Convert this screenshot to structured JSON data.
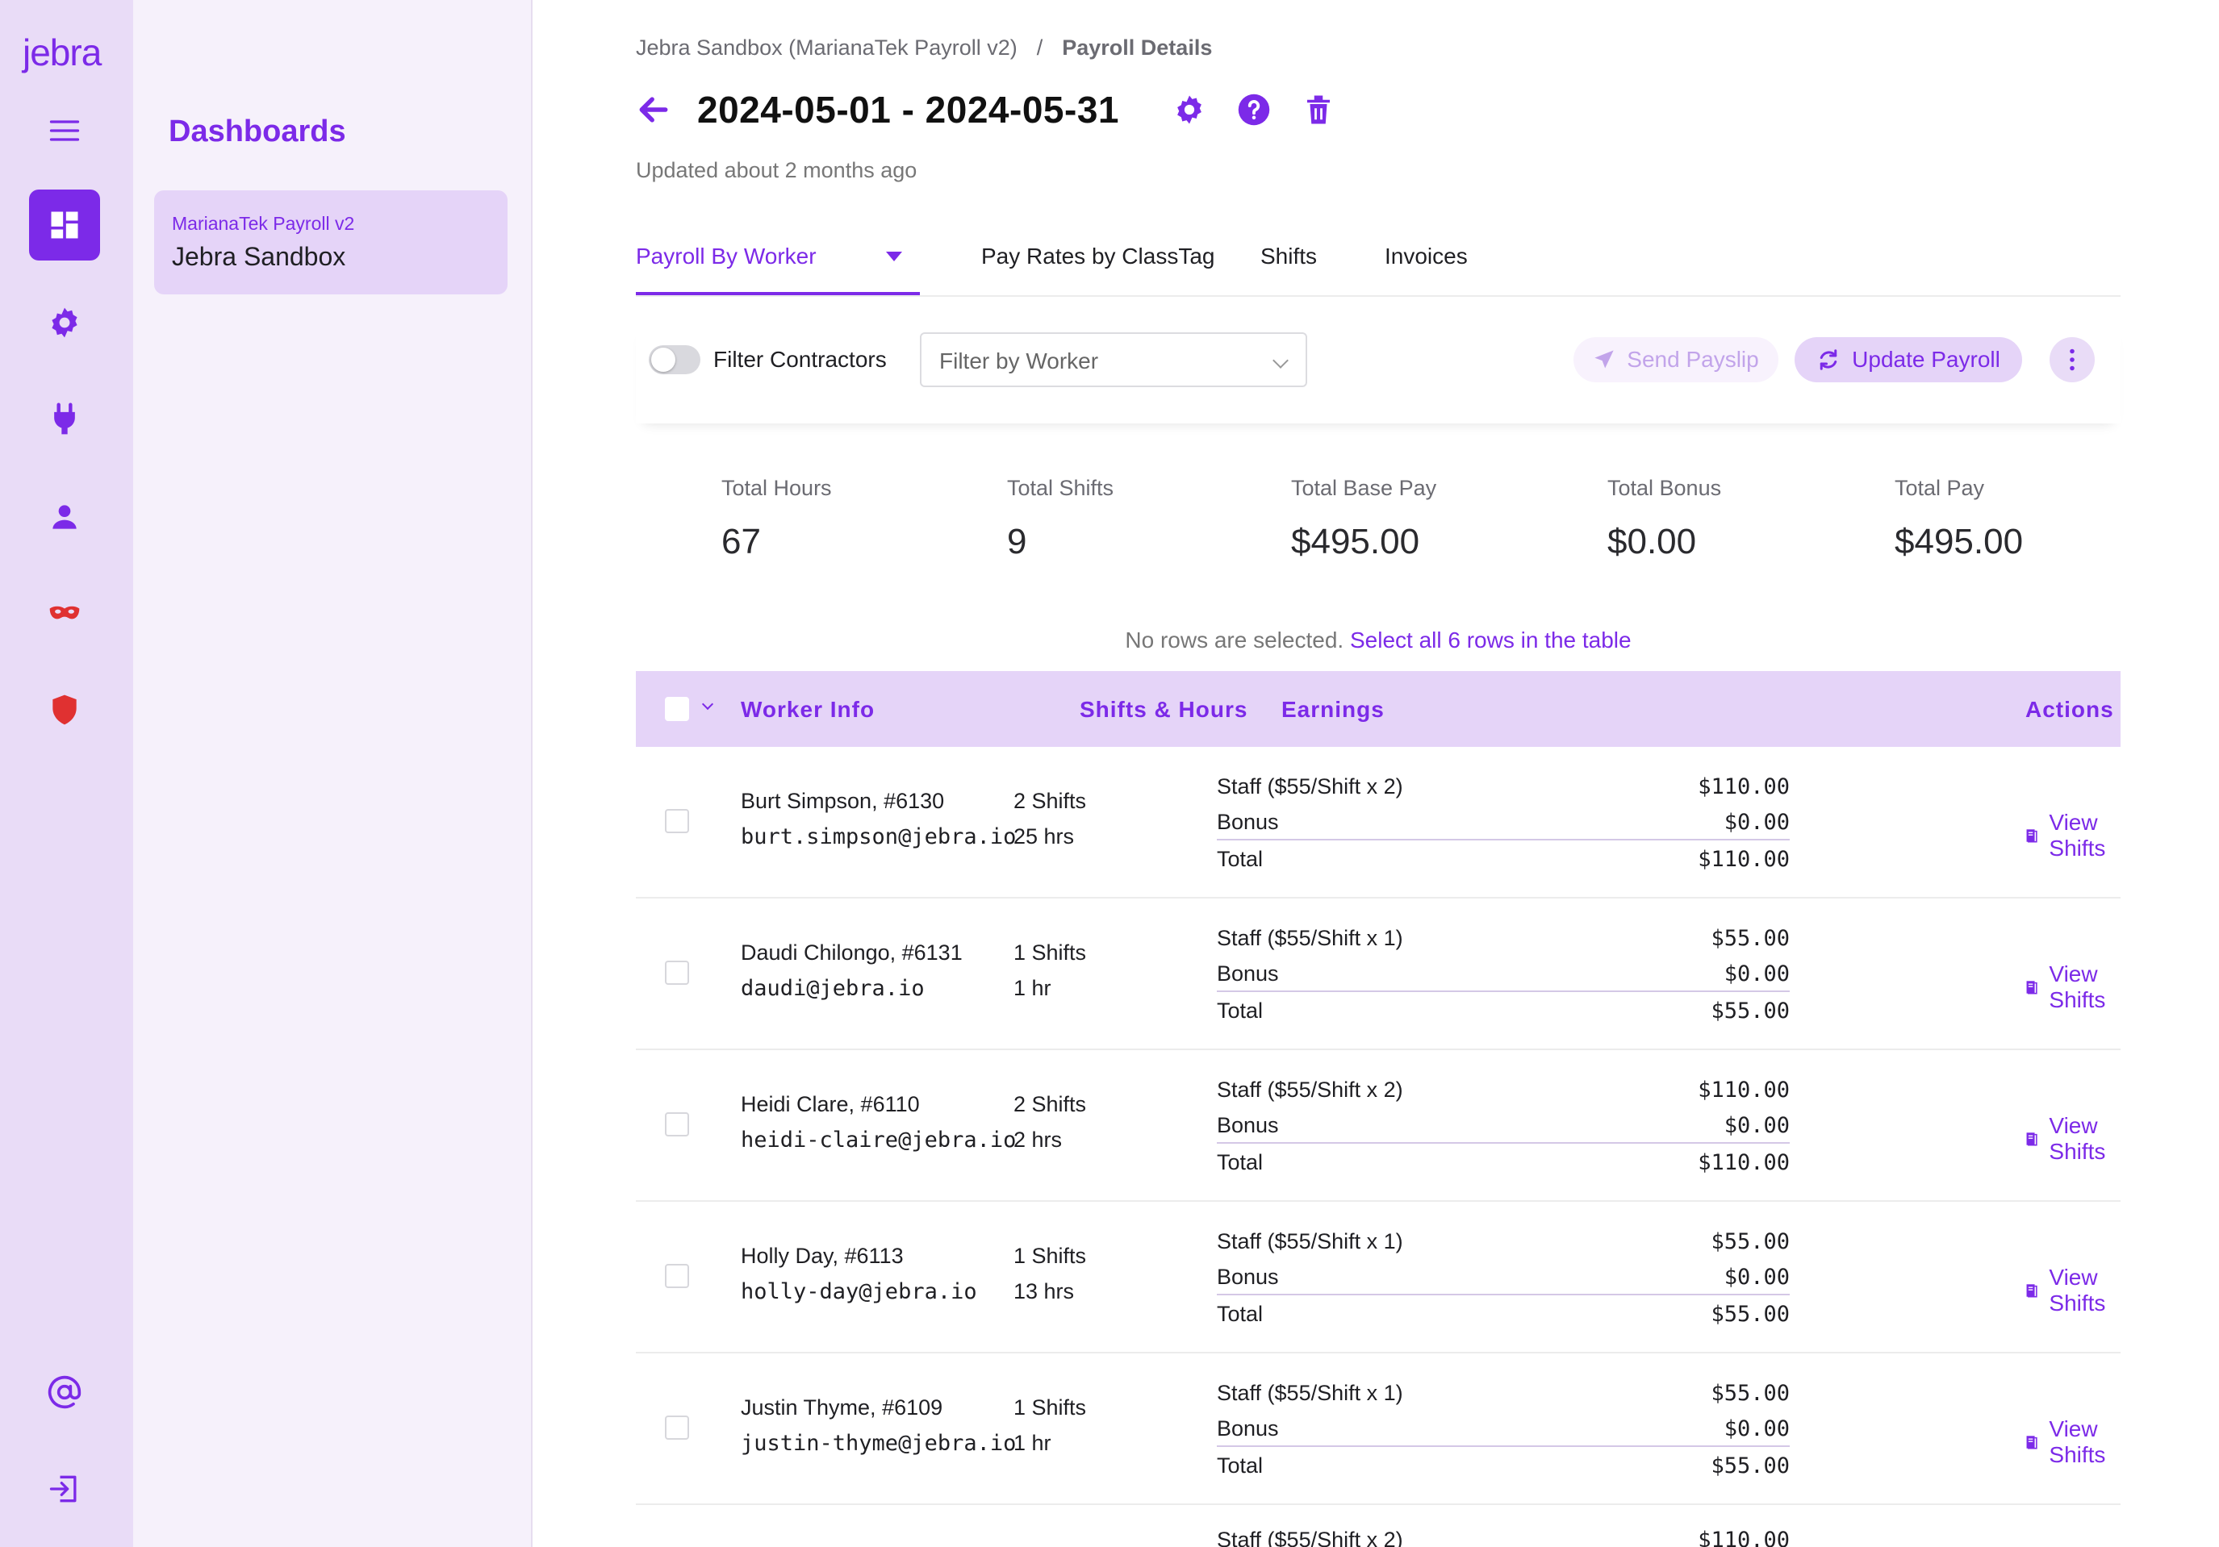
{
  "app": {
    "logo": "jebra"
  },
  "rail": {
    "items": [
      {
        "icon": "menu-icon"
      },
      {
        "icon": "dashboard-icon",
        "active": true
      },
      {
        "icon": "gear-icon"
      },
      {
        "icon": "plug-icon"
      },
      {
        "icon": "user-icon"
      },
      {
        "icon": "mask-icon"
      },
      {
        "icon": "shield-icon"
      },
      {
        "icon": "at-sign-icon"
      },
      {
        "icon": "logout-icon"
      }
    ]
  },
  "sidebar": {
    "title": "Dashboards",
    "card": {
      "subtitle": "MarianaTek Payroll v2",
      "name": "Jebra Sandbox"
    }
  },
  "breadcrumb": {
    "parent": "Jebra Sandbox (MarianaTek Payroll v2)",
    "separator": "/",
    "current": "Payroll Details"
  },
  "header": {
    "title": "2024-05-01 - 2024-05-31",
    "updated": "Updated about 2 months ago"
  },
  "tabs": [
    {
      "label": "Payroll By Worker",
      "active": true
    },
    {
      "label": "Pay Rates by ClassTag"
    },
    {
      "label": "Shifts"
    },
    {
      "label": "Invoices"
    }
  ],
  "toolbar": {
    "filter_contractors_label": "Filter Contractors",
    "filter_contractors_on": false,
    "worker_filter_placeholder": "Filter by Worker",
    "send_payslip": "Send Payslip",
    "update_payroll": "Update Payroll"
  },
  "stats": [
    {
      "label": "Total Hours",
      "value": "67"
    },
    {
      "label": "Total Shifts",
      "value": "9"
    },
    {
      "label": "Total Base Pay",
      "value": "$495.00"
    },
    {
      "label": "Total Bonus",
      "value": "$0.00"
    },
    {
      "label": "Total Pay",
      "value": "$495.00"
    }
  ],
  "selection": {
    "text": "No rows are selected.",
    "link": "Select all 6 rows in the table"
  },
  "table": {
    "headers": {
      "worker": "Worker  Info",
      "shifts": "Shifts  &  Hours",
      "earnings": "Earnings",
      "actions": "Actions"
    },
    "rows": [
      {
        "name": "Burt  Simpson,  #6130",
        "email": "burt.simpson@jebra.io",
        "shifts": "2  Shifts",
        "hours": "25  hrs",
        "staff_label": "Staff  ($55/Shift  x  2)",
        "staff_value": "$110.00",
        "bonus_label": "Bonus",
        "bonus_value": "$0.00",
        "total_label": "Total",
        "total_value": "$110.00",
        "action": "View Shifts"
      },
      {
        "name": "Daudi  Chilongo,  #6131",
        "email": "daudi@jebra.io",
        "shifts": "1  Shifts",
        "hours": "1  hr",
        "staff_label": "Staff  ($55/Shift  x  1)",
        "staff_value": "$55.00",
        "bonus_label": "Bonus",
        "bonus_value": "$0.00",
        "total_label": "Total",
        "total_value": "$55.00",
        "action": "View Shifts"
      },
      {
        "name": "Heidi  Clare,  #6110",
        "email": "heidi-claire@jebra.io",
        "shifts": "2  Shifts",
        "hours": "2  hrs",
        "staff_label": "Staff  ($55/Shift  x  2)",
        "staff_value": "$110.00",
        "bonus_label": "Bonus",
        "bonus_value": "$0.00",
        "total_label": "Total",
        "total_value": "$110.00",
        "action": "View Shifts"
      },
      {
        "name": "Holly  Day,  #6113",
        "email": "holly-day@jebra.io",
        "shifts": "1  Shifts",
        "hours": "13  hrs",
        "staff_label": "Staff  ($55/Shift  x  1)",
        "staff_value": "$55.00",
        "bonus_label": "Bonus",
        "bonus_value": "$0.00",
        "total_label": "Total",
        "total_value": "$55.00",
        "action": "View Shifts"
      },
      {
        "name": "Justin  Thyme,  #6109",
        "email": "justin-thyme@jebra.io",
        "shifts": "1  Shifts",
        "hours": "1  hr",
        "staff_label": "Staff  ($55/Shift  x  1)",
        "staff_value": "$55.00",
        "bonus_label": "Bonus",
        "bonus_value": "$0.00",
        "total_label": "Total",
        "total_value": "$55.00",
        "action": "View Shifts"
      },
      {
        "staff_label": "Staff  ($55/Shift  x  2)",
        "staff_value": "$110.00"
      }
    ]
  },
  "colors": {
    "accent": "#7c2ae8",
    "rail_bg": "#e9dcf7",
    "header_bg": "#e5d4f8",
    "danger": "#e03131"
  }
}
